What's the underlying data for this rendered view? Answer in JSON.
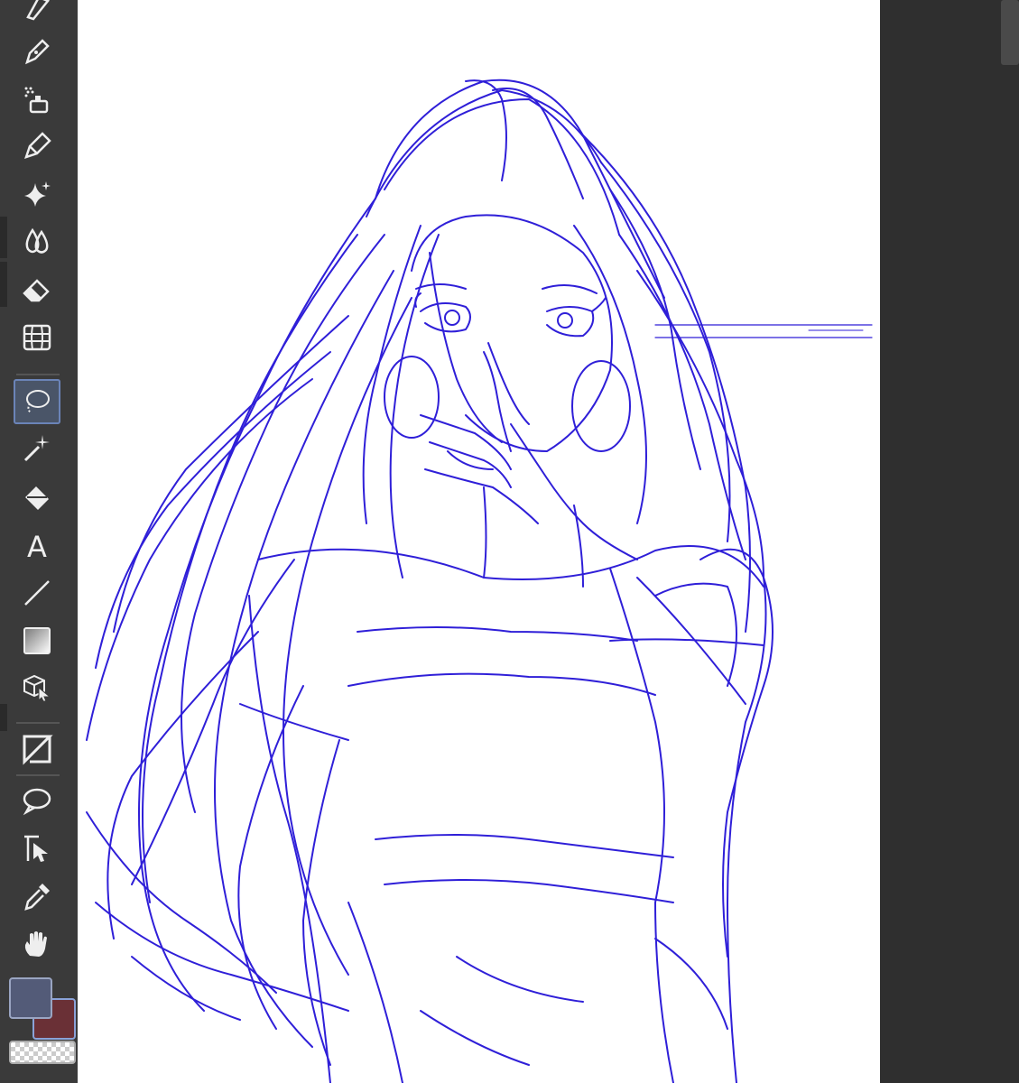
{
  "toolbar": {
    "tools": [
      {
        "icon": "pen-nib-icon",
        "active": false
      },
      {
        "icon": "pen-icon",
        "active": false
      },
      {
        "icon": "airbrush-icon",
        "active": false
      },
      {
        "icon": "decoration-pen-icon",
        "active": false
      },
      {
        "icon": "sparkle-icon",
        "active": false
      },
      {
        "icon": "blend-drops-icon",
        "active": false
      },
      {
        "icon": "eraser-icon",
        "active": false
      },
      {
        "icon": "mesh-transform-icon",
        "active": false
      },
      {
        "icon": "lasso-select-icon",
        "active": true
      },
      {
        "icon": "magic-wand-icon",
        "active": false
      },
      {
        "icon": "paint-bucket-icon",
        "active": false
      },
      {
        "icon": "text-tool-icon",
        "active": false
      },
      {
        "icon": "line-tool-icon",
        "active": false
      },
      {
        "icon": "gradient-icon",
        "active": false
      },
      {
        "icon": "3d-object-icon",
        "active": false
      },
      {
        "icon": "frame-border-icon",
        "active": false
      },
      {
        "icon": "speech-balloon-icon",
        "active": false
      },
      {
        "icon": "correct-line-icon",
        "active": false
      },
      {
        "icon": "eyedropper-icon",
        "active": false
      },
      {
        "icon": "hand-icon",
        "active": false
      }
    ],
    "text_tool_glyph": "A"
  },
  "colors": {
    "main_color": "#535b78",
    "sub_color": "#6a3036",
    "sketch_ink": "#2f1fd8"
  }
}
